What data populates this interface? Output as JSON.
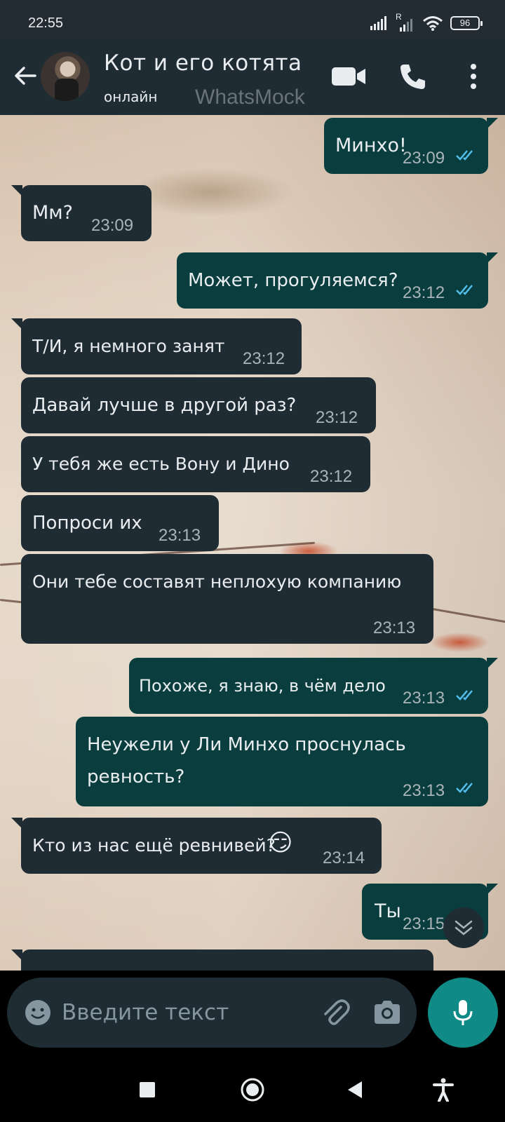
{
  "status_bar": {
    "time": "22:55",
    "battery": "96",
    "signal_label": "R"
  },
  "header": {
    "title": "Кот и его котята",
    "status": "онлайн",
    "watermark": "WhatsMock"
  },
  "messages": [
    {
      "dir": "out",
      "text": "Минхо!",
      "time": "23:09",
      "read": true
    },
    {
      "dir": "in",
      "text": "Мм?",
      "time": "23:09"
    },
    {
      "dir": "out",
      "text": "Может, прогуляемся?",
      "time": "23:12",
      "read": true
    },
    {
      "dir": "in",
      "text": "Т/И, я немного занят",
      "time": "23:12"
    },
    {
      "dir": "in",
      "text": "Давай лучше в другой раз?",
      "time": "23:12"
    },
    {
      "dir": "in",
      "text": "У тебя же есть Вону и Дино",
      "time": "23:12"
    },
    {
      "dir": "in",
      "text": "Попроси их",
      "time": "23:13"
    },
    {
      "dir": "in",
      "text": "Они тебе составят неплохую компанию",
      "time": "23:13"
    },
    {
      "dir": "out",
      "text": "Похоже, я знаю, в чём дело",
      "time": "23:13",
      "read": true
    },
    {
      "dir": "out",
      "text": "Неужели у Ли Минхо проснулась",
      "text2": "ревность?",
      "time": "23:13",
      "read": true
    },
    {
      "dir": "in",
      "text": "Кто из нас ещё ревнивей?",
      "emoji": "😏",
      "time": "23:14"
    },
    {
      "dir": "out",
      "text": "Ты",
      "time": "23:15",
      "read": true
    }
  ],
  "input": {
    "placeholder": "Введите текст"
  },
  "colors": {
    "header_bg": "#1f2c34",
    "incoming_bubble": "#1f2c34",
    "outgoing_bubble": "#0a3d3e",
    "read_ticks": "#53bdeb",
    "mic_button": "#0f8a86"
  },
  "icons": {
    "back": "arrow-left-icon",
    "video": "video-camera-icon",
    "call": "phone-icon",
    "menu": "kebab-menu-icon",
    "emoji": "smiley-icon",
    "attach": "paperclip-icon",
    "camera": "camera-icon",
    "mic": "microphone-icon",
    "scroll_down": "double-chevron-down-icon"
  }
}
